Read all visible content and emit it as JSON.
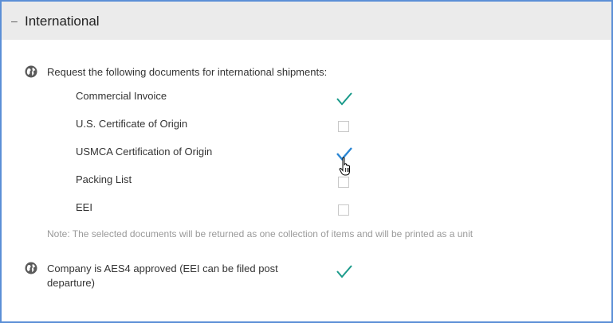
{
  "section": {
    "collapse_symbol": "–",
    "title": "International"
  },
  "request": {
    "label": "Request the following documents for international shipments:",
    "documents": [
      {
        "label": "Commercial Invoice",
        "checked": true
      },
      {
        "label": "U.S. Certificate of Origin",
        "checked": false
      },
      {
        "label": "USMCA Certification of Origin",
        "checked": true
      },
      {
        "label": "Packing List",
        "checked": false
      },
      {
        "label": "EEI",
        "checked": false
      }
    ],
    "note": "Note: The selected documents will be returned as one collection of items and will be printed as a unit"
  },
  "aes4": {
    "label_line1": "Company is AES4 approved (EEI can be filed post",
    "label_line2": "departure)",
    "checked": true
  },
  "colors": {
    "check_teal": "#1a9a8a",
    "check_blue": "#2a86d4",
    "border": "#5b8fd6",
    "header_bg": "#ebebeb"
  },
  "icons": {
    "section_icon": "globe-icon",
    "cursor": "hand-pointer-cursor"
  }
}
